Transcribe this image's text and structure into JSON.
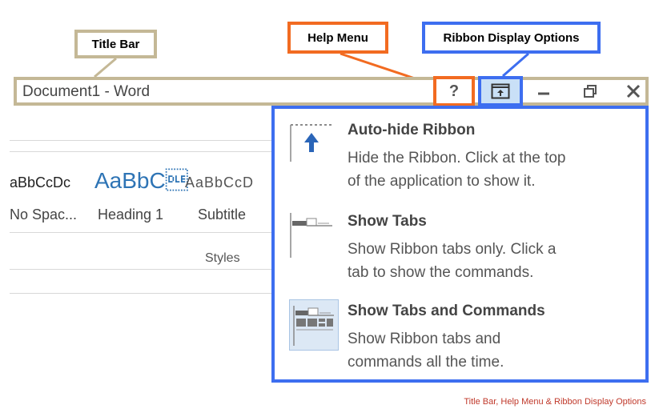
{
  "callouts": {
    "title_bar": "Title Bar",
    "help_menu": "Help Menu",
    "ribbon_display_options": "Ribbon Display Options"
  },
  "titlebar": {
    "doc_title": "Document1 - Word",
    "help_label": "?"
  },
  "ribbon": {
    "style_samples": [
      "aBbCcDc",
      "AaBbC\u0010",
      "AaBbCcD"
    ],
    "style_names": [
      "No Spac...",
      "Heading 1",
      "Subtitle"
    ],
    "group_label": "Styles"
  },
  "dropdown": {
    "items": [
      {
        "title": "Auto-hide Ribbon",
        "desc_line1": "Hide the Ribbon. Click at the top",
        "desc_line2": "of the application to show it.",
        "icon": "auto-hide-icon"
      },
      {
        "title": "Show Tabs",
        "desc_line1": "Show Ribbon tabs only. Click a",
        "desc_line2": "tab to show the commands.",
        "icon": "show-tabs-icon"
      },
      {
        "title": "Show Tabs and Commands",
        "desc_line1": "Show Ribbon tabs and",
        "desc_line2": "commands all the time.",
        "icon": "show-tabs-commands-icon"
      }
    ]
  },
  "caption": "Title Bar, Help Menu & Ribbon Display Options",
  "colors": {
    "title_bar_border": "#c4b896",
    "help_border": "#f26b21",
    "ribbon_border": "#3d6ef0",
    "ribbon_btn_bg": "#c9e0f7",
    "caption": "#c0392b"
  }
}
